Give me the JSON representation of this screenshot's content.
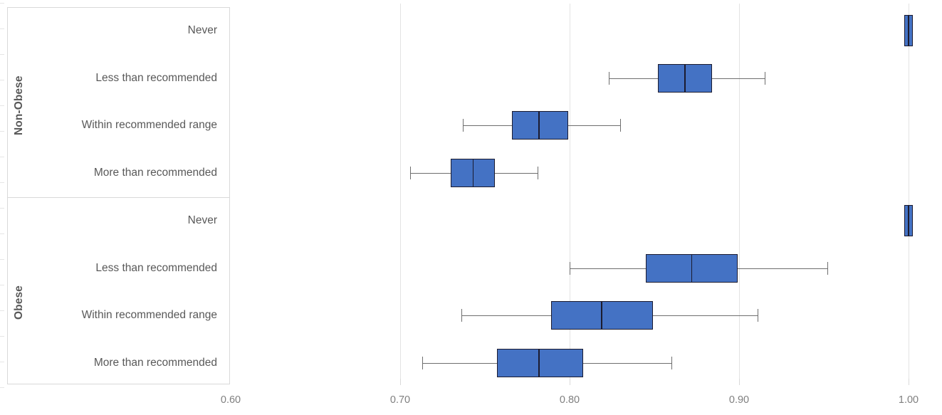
{
  "chart_data": {
    "type": "box",
    "title": "",
    "xlabel": "",
    "ylabel": "",
    "xlim": [
      0.555,
      1.005
    ],
    "xticks": [
      0.6,
      0.7,
      0.8,
      0.9,
      1.0
    ],
    "xtick_labels": [
      "0.60",
      "0.70",
      "0.80",
      "0.90",
      "1.00"
    ],
    "grid": "vertical",
    "orientation": "horizontal",
    "legend": "none",
    "box_fill_color": "#4472C4",
    "box_line_color": "#1B1B2F",
    "whisker_color": "#6E6E6E",
    "groups": [
      {
        "name": "Non-Obese",
        "categories": [
          {
            "label": "Never",
            "min": 0.999,
            "q1": 0.999,
            "median": 1.0,
            "q3": 1.001,
            "max": 1.001
          },
          {
            "label": "Less than recommended",
            "min": 0.823,
            "q1": 0.852,
            "median": 0.868,
            "q3": 0.884,
            "max": 0.915
          },
          {
            "label": "Within recommended range",
            "min": 0.737,
            "q1": 0.766,
            "median": 0.782,
            "q3": 0.799,
            "max": 0.83
          },
          {
            "label": "More than recommended",
            "min": 0.706,
            "q1": 0.73,
            "median": 0.743,
            "q3": 0.756,
            "max": 0.781
          }
        ]
      },
      {
        "name": "Obese",
        "categories": [
          {
            "label": "Never",
            "min": 0.999,
            "q1": 0.999,
            "median": 1.0,
            "q3": 1.001,
            "max": 1.001
          },
          {
            "label": "Less than recommended",
            "min": 0.8,
            "q1": 0.845,
            "median": 0.872,
            "q3": 0.899,
            "max": 0.952
          },
          {
            "label": "Within recommended range",
            "min": 0.736,
            "q1": 0.789,
            "median": 0.819,
            "q3": 0.849,
            "max": 0.911
          },
          {
            "label": "More than recommended",
            "min": 0.713,
            "q1": 0.757,
            "median": 0.782,
            "q3": 0.808,
            "max": 0.86
          }
        ]
      }
    ]
  }
}
